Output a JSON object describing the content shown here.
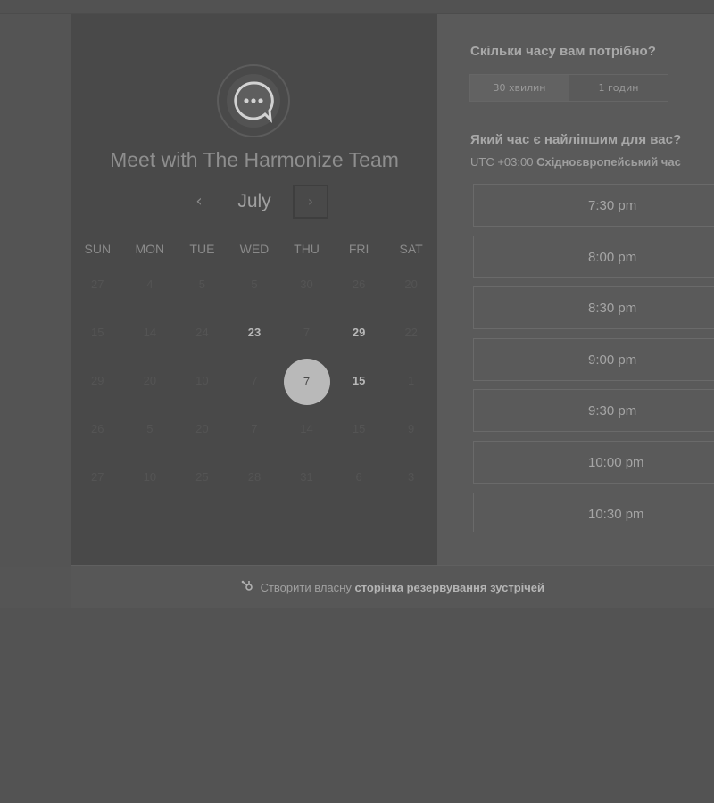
{
  "calendar": {
    "team_title": "Meet with The Harmonize Team",
    "month": "July",
    "prev_icon": "chevron-left-icon",
    "next_icon": "chevron-right-icon",
    "days_of_week": [
      "SUN",
      "MON",
      "TUE",
      "WED",
      "THU",
      "FRI",
      "SAT"
    ],
    "weeks": [
      [
        "27",
        "4",
        "5",
        "5",
        "30",
        "26",
        "20"
      ],
      [
        "15",
        "14",
        "24",
        "23",
        "7",
        "29",
        "22"
      ],
      [
        "29",
        "20",
        "10",
        "7",
        "7",
        "15",
        "1"
      ],
      [
        "26",
        "5",
        "20",
        "7",
        "14",
        "15",
        "9"
      ],
      [
        "27",
        "10",
        "25",
        "28",
        "31",
        "6",
        "3"
      ]
    ],
    "available_days": [
      "23",
      "29",
      "15"
    ],
    "selected_day": "7"
  },
  "booking": {
    "duration_question": "Скільки часу вам потрібно?",
    "durations": [
      "30 хвилин",
      "1 годин"
    ],
    "active_duration": "30 хвилин",
    "time_question": "Який час є найліпшим для вас?",
    "tz_offset": "UTC +03:00",
    "tz_name": "Східноєвропейський час",
    "slots": [
      "7:30 pm",
      "8:00 pm",
      "8:30 pm",
      "9:00 pm",
      "9:30 pm",
      "10:00 pm",
      "10:30 pm"
    ]
  },
  "footer": {
    "icon": "hubspot-sprocket-icon",
    "link_prefix": "Створити власну",
    "link_bold": "сторінка резервування зустрічей"
  }
}
